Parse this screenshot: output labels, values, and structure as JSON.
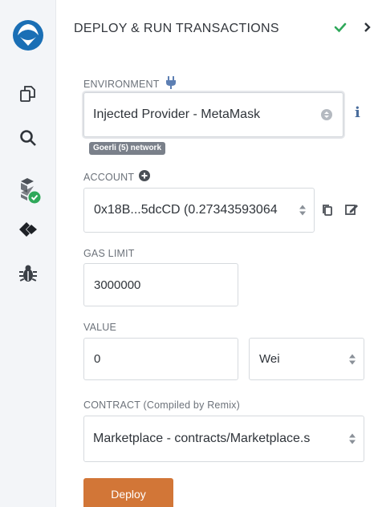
{
  "header": {
    "title": "DEPLOY & RUN TRANSACTIONS"
  },
  "environment": {
    "label": "ENVIRONMENT",
    "value": "Injected Provider - MetaMask",
    "network_badge": "Goerli (5) network"
  },
  "account": {
    "label": "ACCOUNT",
    "value": "0x18B...5dcCD (0.27343593064"
  },
  "gas_limit": {
    "label": "GAS LIMIT",
    "value": "3000000"
  },
  "value": {
    "label": "VALUE",
    "amount": "0",
    "unit": "Wei"
  },
  "contract": {
    "label": "CONTRACT (Compiled by Remix)",
    "value": "Marketplace - contracts/Marketplace.s"
  },
  "deploy_button": {
    "label": "Deploy"
  },
  "colors": {
    "brand_blue": "#1a6fb5",
    "success_green": "#2fa85a",
    "deploy_orange": "#d27637",
    "badge_grey": "#7a808a"
  },
  "icons": {
    "sidebar": [
      "remix-logo-icon",
      "file-explorer-icon",
      "search-icon",
      "solidity-compiler-icon",
      "deploy-run-icon",
      "debugger-icon"
    ],
    "header": [
      "check-icon",
      "chevron-right-icon"
    ],
    "environment": [
      "plug-icon",
      "info-icon"
    ],
    "account": [
      "plus-circle-icon",
      "copy-icon",
      "edit-icon"
    ]
  }
}
